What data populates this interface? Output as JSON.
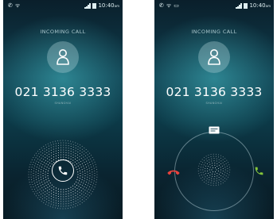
{
  "status_bar": {
    "time": "10:40",
    "ampm": "am"
  },
  "screen1": {
    "title": "INCOMING CALL",
    "number": "021 3136 3333",
    "location": "SHANGHAI"
  },
  "screen2": {
    "title": "INCOMING CALL",
    "number": "021 3136 3333",
    "location": "SHANGHAI"
  },
  "icons": {
    "avatar": "person-icon",
    "answer": "phone-icon",
    "message": "message-icon",
    "decline": "hangup-icon",
    "accept": "phone-icon"
  },
  "colors": {
    "decline": "#e8423d",
    "accept": "#86c63a",
    "text_primary": "#ffffff",
    "text_secondary": "#a9c7cd"
  }
}
